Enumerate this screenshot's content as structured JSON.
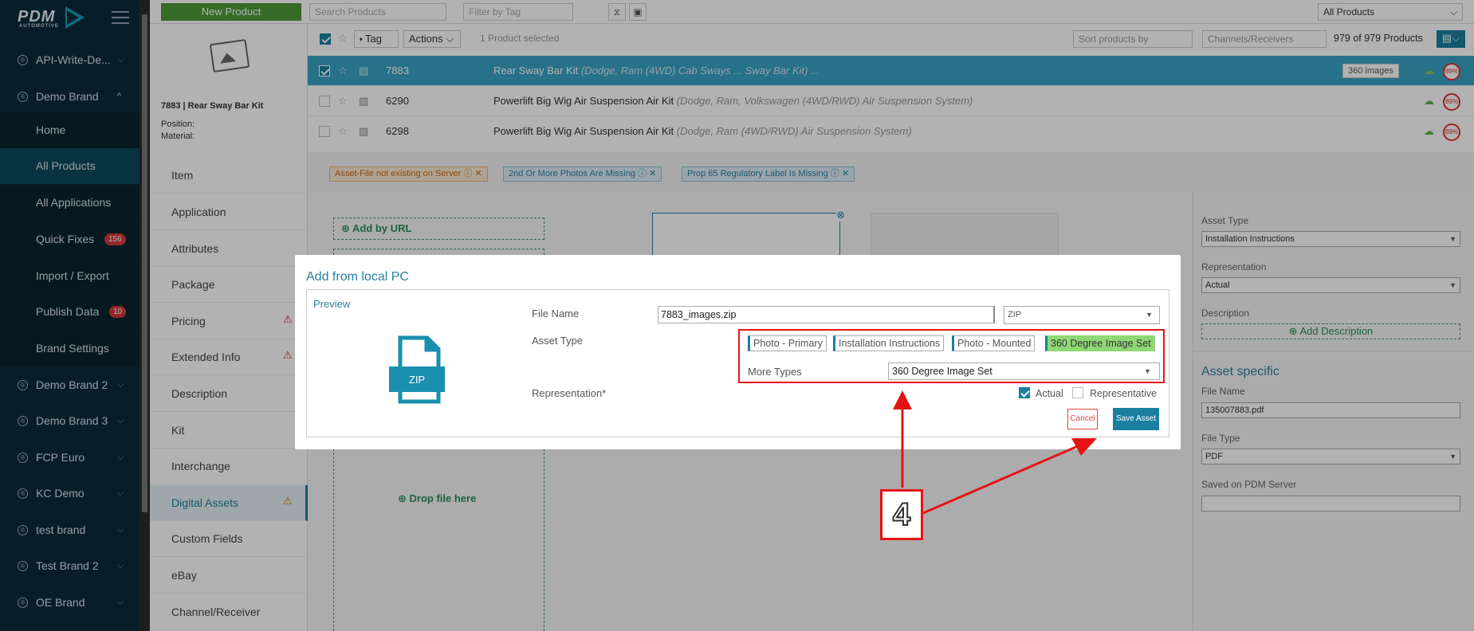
{
  "app": {
    "logo": "PDM",
    "logo_sub": "AUTOMOTIVE"
  },
  "sidebar": {
    "items": [
      {
        "label": "API-Write-De...",
        "type": "brand",
        "expanded": false
      },
      {
        "label": "Demo Brand",
        "type": "brand",
        "expanded": true
      },
      {
        "label": "Home",
        "type": "sub"
      },
      {
        "label": "All Products",
        "type": "sub",
        "active": true
      },
      {
        "label": "All Applications",
        "type": "sub"
      },
      {
        "label": "Quick Fixes",
        "type": "sub",
        "badge": "156"
      },
      {
        "label": "Import / Export",
        "type": "sub"
      },
      {
        "label": "Publish Data",
        "type": "sub",
        "badge": "10"
      },
      {
        "label": "Brand Settings",
        "type": "sub"
      },
      {
        "label": "Demo Brand 2",
        "type": "brand"
      },
      {
        "label": "Demo Brand 3",
        "type": "brand"
      },
      {
        "label": "FCP Euro",
        "type": "brand"
      },
      {
        "label": "KC Demo",
        "type": "brand"
      },
      {
        "label": "test brand",
        "type": "brand"
      },
      {
        "label": "Test Brand 2",
        "type": "brand"
      },
      {
        "label": "OE Brand",
        "type": "brand"
      }
    ]
  },
  "topbar": {
    "new_product": "New Product",
    "search_placeholder": "Search Products",
    "tag_placeholder": "Filter by Tag",
    "scope": "All Products"
  },
  "product": {
    "header": "7883 | Rear Sway Bar Kit",
    "position_label": "Position:",
    "material_label": "Material:",
    "tabs": [
      {
        "label": "Item"
      },
      {
        "label": "Application"
      },
      {
        "label": "Attributes"
      },
      {
        "label": "Package"
      },
      {
        "label": "Pricing",
        "warn": "red"
      },
      {
        "label": "Extended Info",
        "warn": "red"
      },
      {
        "label": "Description"
      },
      {
        "label": "Kit"
      },
      {
        "label": "Interchange"
      },
      {
        "label": "Digital Assets",
        "active": true,
        "warn": "orange"
      },
      {
        "label": "Custom Fields"
      },
      {
        "label": "eBay"
      },
      {
        "label": "Channel/Receiver"
      }
    ]
  },
  "list": {
    "tag_btn": "Tag",
    "actions_btn": "Actions",
    "selected_text": "1 Product selected",
    "sort_placeholder": "Sort products by",
    "channels_placeholder": "Channels/Receivers",
    "count": "979 of 979 Products",
    "rows": [
      {
        "num": "7883",
        "title": "Rear Sway Bar Kit",
        "desc": "(Dodge, Ram (4WD) Cab Sways ... Sway Bar Kit) ...",
        "selected": true,
        "badge": "360 images",
        "score": "89%"
      },
      {
        "num": "6290",
        "title": "Powerlift Big Wig Air Suspension Air Kit",
        "desc": "(Dodge, Ram, Volkswagen (4WD/RWD) Air Suspension System)",
        "score": "89%"
      },
      {
        "num": "6298",
        "title": "Powerlift Big Wig Air Suspension Air Kit",
        "desc": "(Dodge, Ram (4WD/RWD) Air Suspension System)",
        "score": "89%"
      }
    ]
  },
  "warnings": [
    {
      "label": "Asset-File not existing on Server",
      "color": "orange"
    },
    {
      "label": "2nd Or More Photos Are Missing",
      "color": "blue"
    },
    {
      "label": "Prop 65 Regulatory Label Is Missing",
      "color": "blue"
    }
  ],
  "asset_area": {
    "add_by_url": "Add by URL",
    "drop_file": "Drop file here"
  },
  "asset_side": {
    "asset_type_label": "Asset Type",
    "asset_type_value": "Installation Instructions",
    "representation_label": "Representation",
    "representation_value": "Actual",
    "description_label": "Description",
    "add_description": "Add Description",
    "asset_specific_title": "Asset specific",
    "file_name_label": "File Name",
    "file_name_value": "135007883.pdf",
    "file_type_label": "File Type",
    "file_type_value": "PDF",
    "saved_label": "Saved on PDM Server"
  },
  "modal": {
    "title": "Add from local PC",
    "preview": "Preview",
    "file_icon_label": "ZIP",
    "file_name_label": "File Name",
    "file_name_value": "7883_images.zip",
    "file_ext": "ZIP",
    "asset_type_label": "Asset Type",
    "asset_types": [
      {
        "label": "Photo - Primary"
      },
      {
        "label": "Installation Instructions"
      },
      {
        "label": "Photo - Mounted"
      },
      {
        "label": "360 Degree Image Set",
        "selected": true
      }
    ],
    "more_types_label": "More Types",
    "more_types_value": "360 Degree Image Set",
    "representation_label": "Representation*",
    "actual_label": "Actual",
    "actual_checked": true,
    "representative_label": "Representative",
    "representative_checked": false,
    "cancel": "Cancel",
    "save": "Save Asset"
  },
  "annotation": {
    "step": "4",
    "color": "#e51414"
  }
}
